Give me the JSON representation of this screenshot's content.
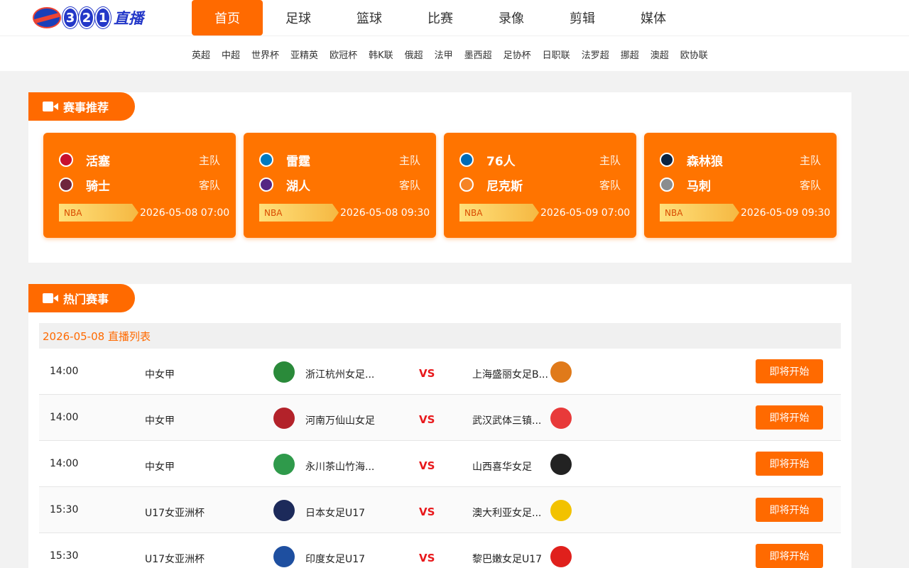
{
  "brand": {
    "digits": [
      "3",
      "2",
      "1"
    ],
    "text": "直播"
  },
  "main_nav": [
    "首页",
    "足球",
    "篮球",
    "比赛",
    "录像",
    "剪辑",
    "媒体"
  ],
  "sub_nav": [
    "英超",
    "中超",
    "世界杯",
    "亚精英",
    "欧冠杯",
    "韩K联",
    "俄超",
    "法甲",
    "墨西超",
    "足协杯",
    "日职联",
    "法罗超",
    "挪超",
    "澳超",
    "欧协联"
  ],
  "recommend": {
    "title": "赛事推荐",
    "cards": [
      {
        "home": "活塞",
        "away": "骑士",
        "home_role": "主队",
        "away_role": "客队",
        "league": "NBA",
        "time": "2026-05-08 07:00",
        "home_color": "#c8102e",
        "away_color": "#6f263d"
      },
      {
        "home": "雷霆",
        "away": "湖人",
        "home_role": "主队",
        "away_role": "客队",
        "league": "NBA",
        "time": "2026-05-08 09:30",
        "home_color": "#007ac1",
        "away_color": "#552583"
      },
      {
        "home": "76人",
        "away": "尼克斯",
        "home_role": "主队",
        "away_role": "客队",
        "league": "NBA",
        "time": "2026-05-09 07:00",
        "home_color": "#006bb6",
        "away_color": "#f58426"
      },
      {
        "home": "森林狼",
        "away": "马刺",
        "home_role": "主队",
        "away_role": "客队",
        "league": "NBA",
        "time": "2026-05-09 09:30",
        "home_color": "#0c2340",
        "away_color": "#8a8d8f"
      }
    ]
  },
  "hot": {
    "title": "热门赛事",
    "date_label": "2026-05-08 直播列表",
    "vs": "VS",
    "rows": [
      {
        "time": "14:00",
        "league": "中女甲",
        "home": "浙江杭州女足...",
        "away": "上海盛丽女足B...",
        "status": "即将开始",
        "home_color": "#2a8a3a",
        "away_color": "#e07a1a"
      },
      {
        "time": "14:00",
        "league": "中女甲",
        "home": "河南万仙山女足",
        "away": "武汉武体三镇...",
        "status": "即将开始",
        "home_color": "#b3222a",
        "away_color": "#e83a3a"
      },
      {
        "time": "14:00",
        "league": "中女甲",
        "home": "永川茶山竹海...",
        "away": "山西喜华女足",
        "status": "即将开始",
        "home_color": "#2f9a4b",
        "away_color": "#222222"
      },
      {
        "time": "15:30",
        "league": "U17女亚洲杯",
        "home": "日本女足U17",
        "away": "澳大利亚女足...",
        "status": "即将开始",
        "home_color": "#1c2a5a",
        "away_color": "#f2c200"
      },
      {
        "time": "15:30",
        "league": "U17女亚洲杯",
        "home": "印度女足U17",
        "away": "黎巴嫩女足U17",
        "status": "即将开始",
        "home_color": "#1e4fa0",
        "away_color": "#e0201c"
      }
    ]
  }
}
